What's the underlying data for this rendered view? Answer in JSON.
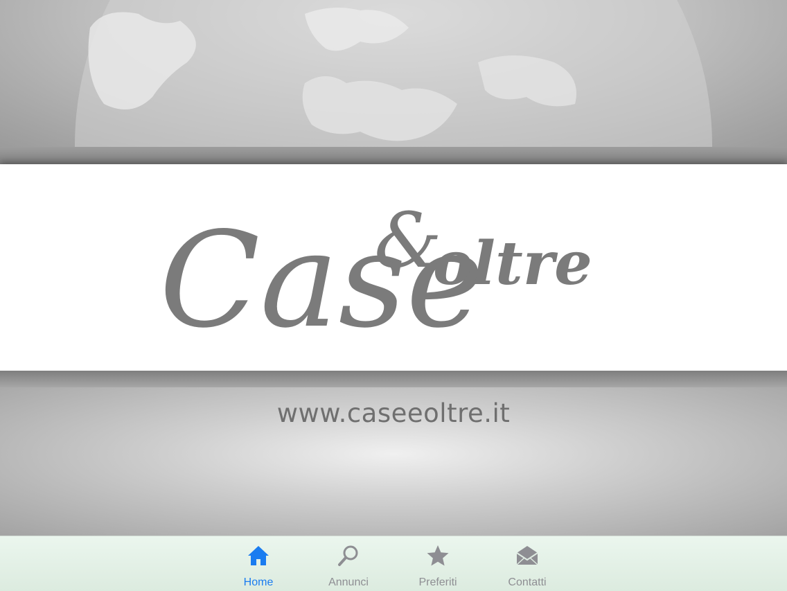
{
  "brand": {
    "logo_text_main": "Case",
    "logo_text_amp": "&",
    "logo_text_second": "oltre",
    "website": "www.caseeoltre.it",
    "logo_color": "#7b7b7b"
  },
  "tabbar": {
    "active_color": "#1a7cf0",
    "inactive_color": "#8e8e93",
    "tabs": [
      {
        "label": "Home",
        "icon": "house-icon",
        "active": true
      },
      {
        "label": "Annunci",
        "icon": "magnifier-icon",
        "active": false
      },
      {
        "label": "Preferiti",
        "icon": "star-icon",
        "active": false
      },
      {
        "label": "Contatti",
        "icon": "envelope-icon",
        "active": false
      }
    ]
  }
}
